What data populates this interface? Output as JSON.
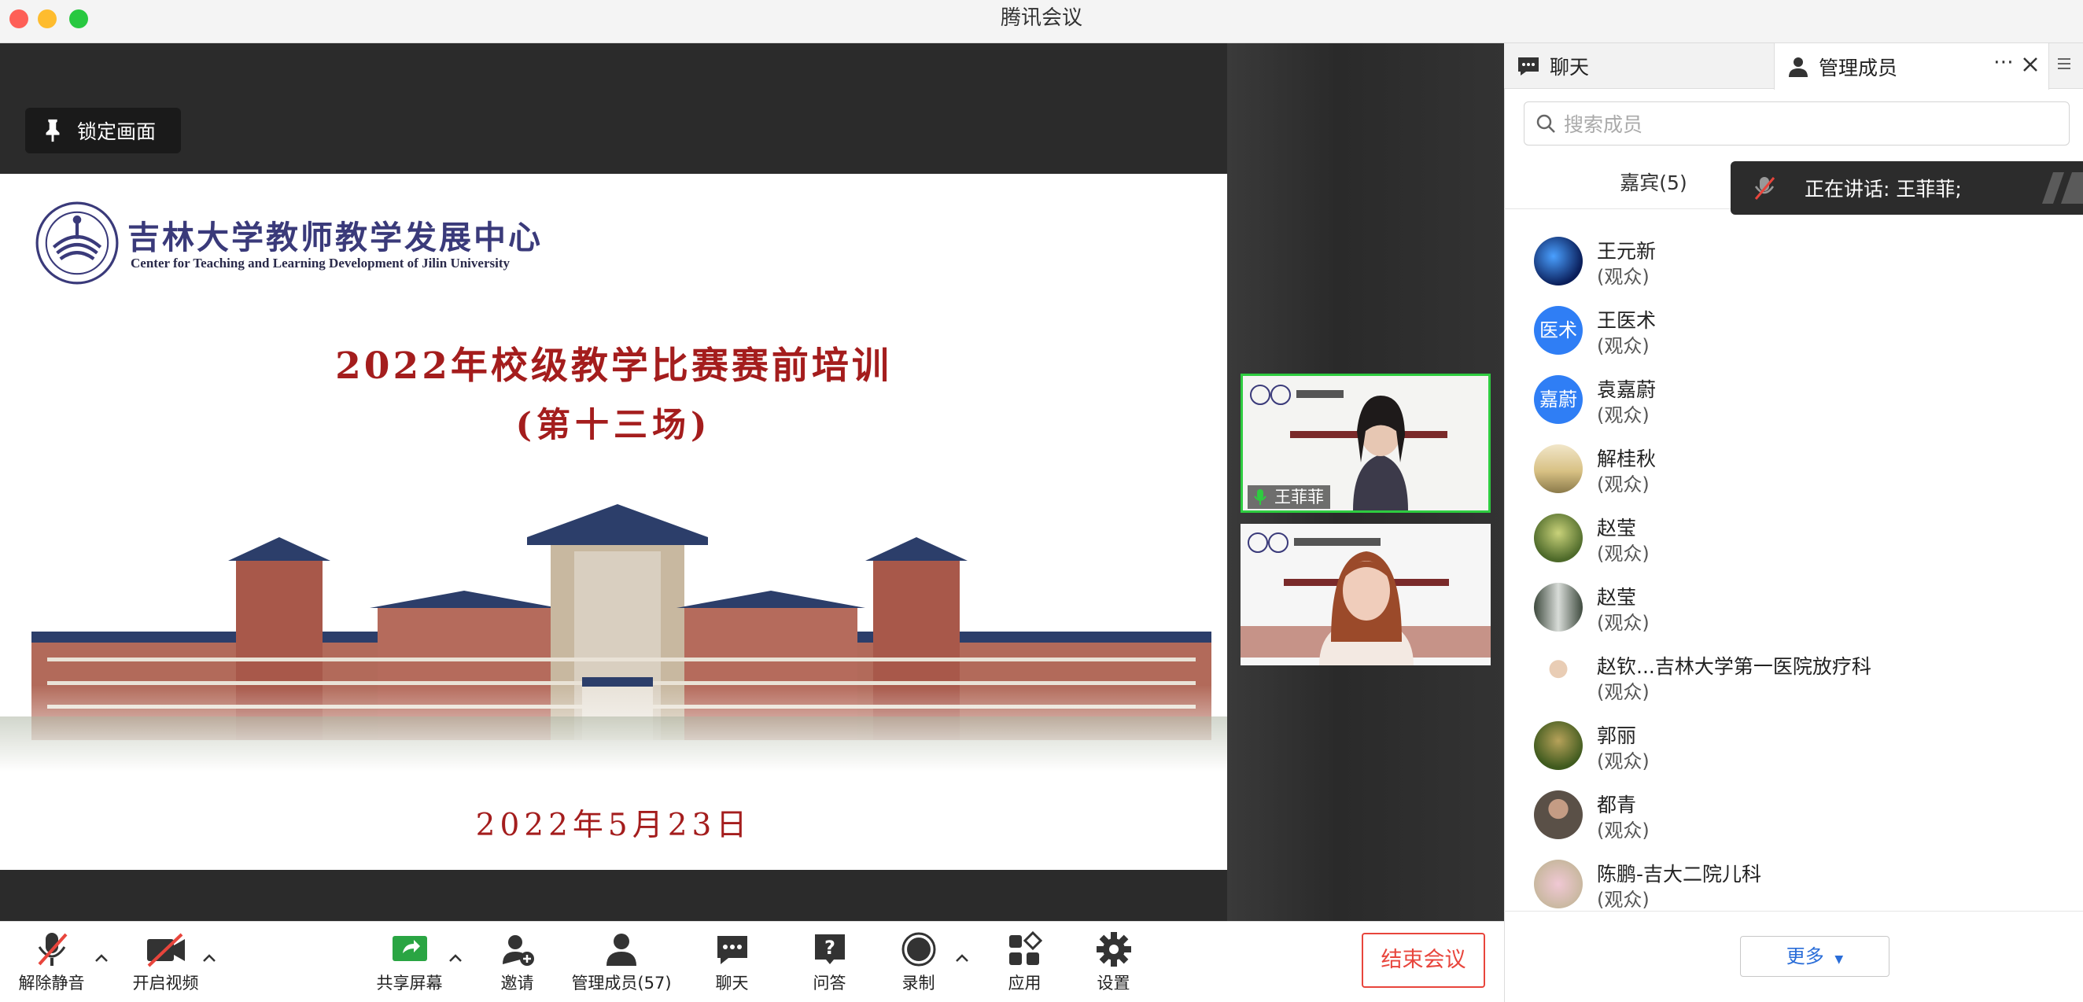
{
  "window": {
    "title": "腾讯会议",
    "traffic_colors": [
      "#fe5f57",
      "#febc2e",
      "#28c840"
    ]
  },
  "stage": {
    "lock_label": "锁定画面"
  },
  "slide": {
    "org_cn": "吉林大学教师教学发展中心",
    "org_en": "Center for Teaching and Learning Development of Jilin University",
    "title": "2022年校级教学比赛赛前培训",
    "subtitle": "(第十三场)",
    "date": "2022年5月23日",
    "title_color": "#a41d1d"
  },
  "videos": [
    {
      "name": "王菲菲",
      "speaking": true
    },
    {
      "name": "",
      "speaking": false
    }
  ],
  "toolbar": {
    "unmute": "解除静音",
    "start_video": "开启视频",
    "share_screen": "共享屏幕",
    "invite": "邀请",
    "manage_members": "管理成员(57)",
    "chat": "聊天",
    "qa": "问答",
    "record": "录制",
    "apps": "应用",
    "settings": "设置",
    "end_meeting": "结束会议"
  },
  "panel": {
    "tab_chat": "聊天",
    "tab_members": "管理成员",
    "search_placeholder": "搜索成员",
    "guest_tab": "嘉宾(5)",
    "speaking_label": "正在讲话: 王菲菲;",
    "more": "更多",
    "members": [
      {
        "name": "王元新",
        "role": "(观众)",
        "avatar": "photo-blue"
      },
      {
        "name": "王医术",
        "role": "(观众)",
        "avatar": "text",
        "avatar_text": "医术",
        "avatar_color": "#2f7ef5"
      },
      {
        "name": "袁嘉蔚",
        "role": "(观众)",
        "avatar": "text",
        "avatar_text": "嘉蔚",
        "avatar_color": "#2f7ef5"
      },
      {
        "name": "解桂秋",
        "role": "(观众)",
        "avatar": "photo-landscape"
      },
      {
        "name": "赵莹",
        "role": "(观众)",
        "avatar": "photo-plant"
      },
      {
        "name": "赵莹",
        "role": "(观众)",
        "avatar": "photo-waterfall"
      },
      {
        "name": "赵钦...吉林大学第一医院放疗科",
        "role": "(观众)",
        "avatar": "photo-doctor"
      },
      {
        "name": "郭丽",
        "role": "(观众)",
        "avatar": "photo-plant2"
      },
      {
        "name": "都青",
        "role": "(观众)",
        "avatar": "photo-person"
      },
      {
        "name": "陈鹏-吉大二院儿科",
        "role": "(观众)",
        "avatar": "photo-flower"
      }
    ]
  }
}
